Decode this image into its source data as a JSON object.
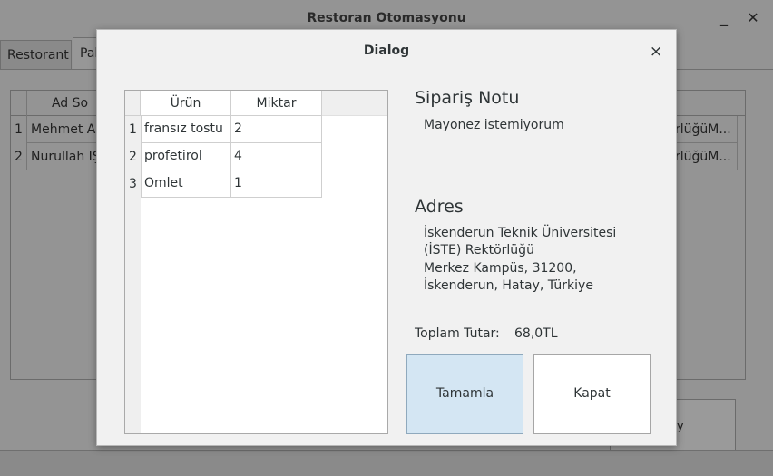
{
  "main_window": {
    "title": "Restoran Otomasyonu",
    "minimize_glyph": "_",
    "close_glyph": "✕",
    "tabs": [
      {
        "label": "Restorant"
      },
      {
        "label": "Pal"
      }
    ],
    "table": {
      "header": "Ad So",
      "rows": [
        {
          "num": "1",
          "name": "Mehmet Ali",
          "right": "rlüğüM..."
        },
        {
          "num": "2",
          "name": "Nurullah IŞ",
          "right": "rlüğüM..."
        }
      ]
    },
    "button_partial": "ay"
  },
  "dialog": {
    "title": "Dialog",
    "close_glyph": "×",
    "order_table": {
      "columns": [
        "Ürün",
        "Miktar"
      ],
      "rows": [
        {
          "num": "1",
          "product": "fransız tostu",
          "qty": "2"
        },
        {
          "num": "2",
          "product": "profetirol",
          "qty": "4"
        },
        {
          "num": "3",
          "product": "Omlet",
          "qty": "1"
        }
      ]
    },
    "note": {
      "title": "Sipariş Notu",
      "text": "Mayonez istemiyorum"
    },
    "address": {
      "title": "Adres",
      "lines": [
        "İskenderun Teknik Üniversitesi",
        "(İSTE) Rektörlüğü",
        "Merkez Kampüs, 31200,",
        "İskenderun, Hatay, Türkiye"
      ]
    },
    "total": {
      "label": "Toplam Tutar:",
      "value": "68,0TL"
    },
    "buttons": {
      "complete": "Tamamla",
      "close": "Kapat"
    }
  },
  "colors": {
    "dialog_bg": "#f1f1f1",
    "primary_button_bg": "#d4e6f3",
    "dimmed_bg": "#949494"
  }
}
